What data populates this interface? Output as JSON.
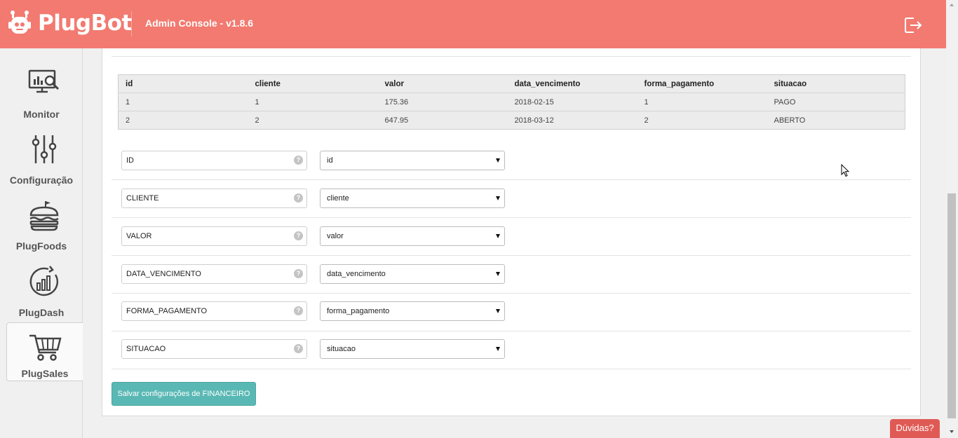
{
  "header": {
    "brand": "PlugBot",
    "app_title": "Admin Console - v1.8.6"
  },
  "sidebar": {
    "items": [
      {
        "label": "Monitor",
        "icon": "monitor-chart-icon"
      },
      {
        "label": "Configuração",
        "icon": "sliders-icon"
      },
      {
        "label": "PlugFoods",
        "icon": "burger-icon"
      },
      {
        "label": "PlugDash",
        "icon": "dashboard-chart-icon"
      },
      {
        "label": "PlugSales",
        "icon": "shopping-cart-icon",
        "active": true
      }
    ]
  },
  "table": {
    "columns": [
      "id",
      "cliente",
      "valor",
      "data_vencimento",
      "forma_pagamento",
      "situacao"
    ],
    "rows": [
      [
        "1",
        "1",
        "175.36",
        "2018-02-15",
        "1",
        "PAGO"
      ],
      [
        "2",
        "2",
        "647.95",
        "2018-03-12",
        "2",
        "ABERTO"
      ]
    ]
  },
  "mappings": [
    {
      "field": "ID",
      "column": "id"
    },
    {
      "field": "CLIENTE",
      "column": "cliente"
    },
    {
      "field": "VALOR",
      "column": "valor"
    },
    {
      "field": "DATA_VENCIMENTO",
      "column": "data_vencimento"
    },
    {
      "field": "FORMA_PAGAMENTO",
      "column": "forma_pagamento"
    },
    {
      "field": "SITUACAO",
      "column": "situacao"
    }
  ],
  "help_glyph": "?",
  "save_button": "Salvar configurações de FINANCEIRO",
  "help_tab": "Dúvidas?",
  "colors": {
    "header": "#f27a70",
    "accent_button": "#5ab8b4",
    "help_tab": "#e05a55"
  }
}
